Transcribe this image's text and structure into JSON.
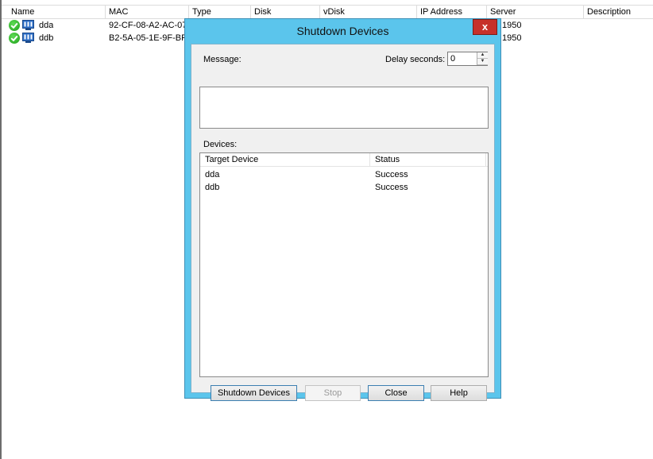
{
  "list": {
    "columns": [
      "Name",
      "MAC",
      "Type",
      "Disk",
      "vDisk",
      "IP Address",
      "Server",
      "Description"
    ],
    "rows": [
      {
        "name": "dda",
        "mac": "92-CF-08-A2-AC-07",
        "server": "1950"
      },
      {
        "name": "ddb",
        "mac": "B2-5A-05-1E-9F-BF",
        "server": "1950"
      }
    ]
  },
  "dialog": {
    "title": "Shutdown Devices",
    "close_label": "x",
    "message_label": "Message:",
    "message_value": "",
    "delay_label": "Delay seconds:",
    "delay_value": "0",
    "devices_label": "Devices:",
    "devices_columns": [
      "Target Device",
      "Status"
    ],
    "devices": [
      {
        "device": "dda",
        "status": "Success"
      },
      {
        "device": "ddb",
        "status": "Success"
      }
    ],
    "buttons": {
      "shutdown": "Shutdown Devices",
      "stop": "Stop",
      "close": "Close",
      "help": "Help"
    }
  },
  "icons": {
    "status": "success-check-icon",
    "device": "target-device-icon"
  },
  "colors": {
    "dialog_frame": "#5bc5ec",
    "close_button": "#c7312a"
  }
}
